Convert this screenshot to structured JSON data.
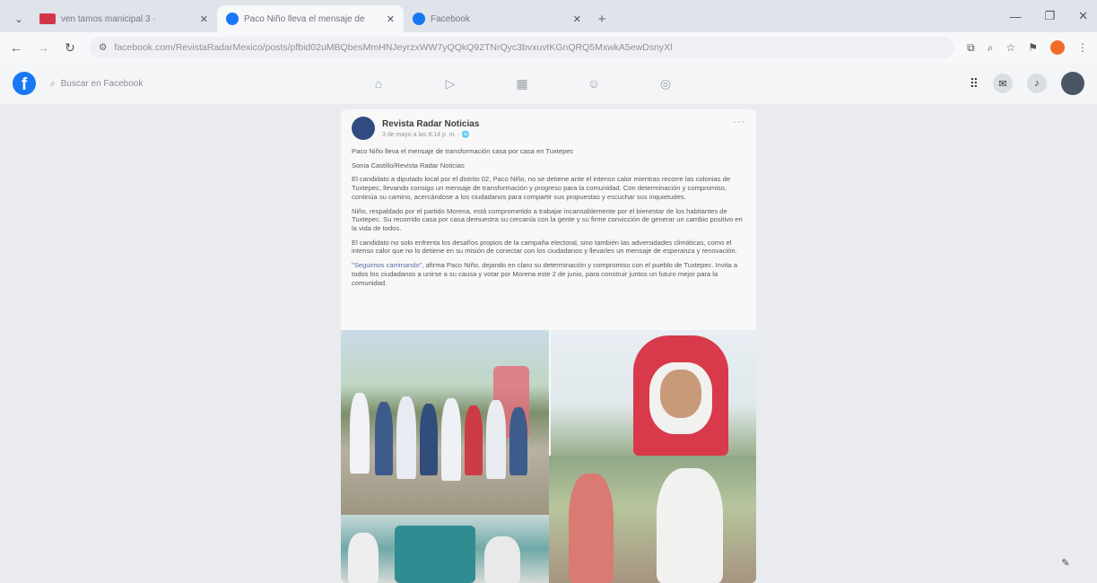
{
  "browser": {
    "tabs": [
      {
        "title": "ven tamos manicipal 3 ·",
        "favicon": "red-tab-icon"
      },
      {
        "title": "Paco Niño lleva el mensaje de",
        "favicon": "facebook-icon"
      },
      {
        "title": "Facebook",
        "favicon": "facebook-icon"
      }
    ],
    "url": "facebook.com/RevistaRadarMexico/posts/pfbid02uMBQbesMmHNJeyrzxWW7yQQkQ92TNrQyc3bvxuvtKGnQRQ5MxwkA5ewDsnyXl"
  },
  "facebook": {
    "search_placeholder": "Buscar en Facebook"
  },
  "post": {
    "page_name": "Revista Radar Noticias",
    "meta": "3 de mayo a las 8:14 p. m. · 🌐",
    "headline": "Paco Niño lleva el mensaje de transformación casa por casa en Tuxtepec",
    "byline": "Sonia Castillo/Revista Radar Noticias",
    "paragraphs": [
      "El candidato a diputado local por el distrito 02, Paco Niño, no se detiene ante el intenso calor mientras recorre las colonias de Tuxtepec, llevando consigo un mensaje de transformación y progreso para la comunidad. Con determinación y compromiso, continúa su camino, acercándose a los ciudadanos para compartir sus propuestas y escuchar sus inquietudes.",
      "Niño, respaldado por el partido Morena, está comprometido a trabajar incansablemente por el bienestar de los habitantes de Tuxtepec. Su recorrido casa por casa demuestra su cercanía con la gente y su firme convicción de generar un cambio positivo en la vida de todos.",
      "El candidato no solo enfrenta los desafíos propios de la campaña electoral, sino también las adversidades climáticas, como el intenso calor que no lo detiene en su misión de conectar con los ciudadanos y llevarles un mensaje de esperanza y renovación."
    ],
    "quote": "\"Seguimos caminando\",",
    "closing": " afirma Paco Niño, dejando en claro su determinación y compromiso con el pueblo de Tuxtepec. Invita a todos los ciudadanos a unirse a su causa y votar por Morena este 2 de junio, para construir juntos un futuro mejor para la comunidad."
  },
  "colors": {
    "facebook_blue": "#1877f2",
    "tab_red": "#d2344a"
  }
}
